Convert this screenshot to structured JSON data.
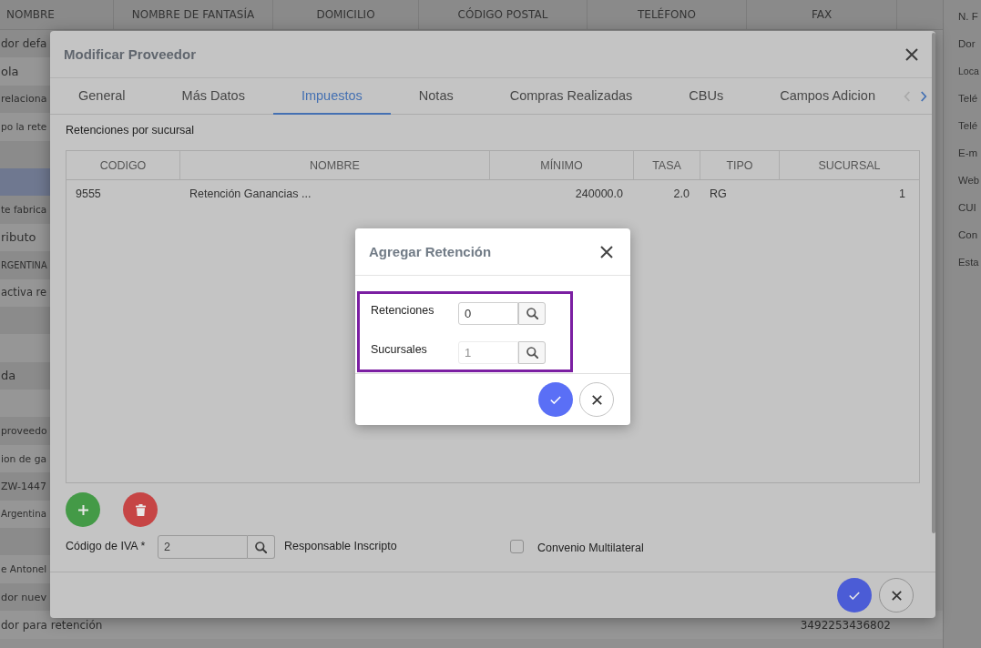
{
  "app": {
    "columns": [
      "NOMBRE",
      "NOMBRE DE FANTASÍA",
      "DOMICILIO",
      "CÓDIGO POSTAL",
      "TELÉFONO",
      "FAX"
    ],
    "rows": [
      {
        "name": "dor defa",
        "selected": false
      },
      {
        "name": "ola",
        "selected": false
      },
      {
        "name": "relaciona",
        "selected": false
      },
      {
        "name": "po la rete",
        "selected": false
      },
      {
        "selected": false
      },
      {
        "selected": true
      },
      {
        "name": "te fabrica",
        "selected": false
      },
      {
        "name": "ributo",
        "selected": false
      },
      {
        "name": "RGENTINA",
        "selected": false
      },
      {
        "name": "activa re",
        "selected": false
      },
      {
        "selected": false
      },
      {
        "selected": false
      },
      {
        "name": "da",
        "selected": false
      },
      {
        "selected": false
      },
      {
        "name": "proveedo",
        "selected": false
      },
      {
        "name": "ion de ga",
        "selected": false
      },
      {
        "name": "ZW-1447",
        "selected": false
      },
      {
        "name": "Argentina",
        "selected": false
      },
      {
        "selected": false
      },
      {
        "name": "e Antonel",
        "selected": false
      },
      {
        "name": "dor nuev",
        "selected": false
      },
      {
        "name": "dor para retención",
        "fax": "3492253436802",
        "selected": false
      }
    ]
  },
  "detail_panel": {
    "labels": [
      "N. F",
      "Dor",
      "Loca",
      "Telé",
      "Telé",
      "E-m",
      "Web",
      "CUI",
      "Con",
      "Esta"
    ]
  },
  "dialog": {
    "title": "Modificar Proveedor",
    "tabs": [
      {
        "label": "General",
        "selected": false
      },
      {
        "label": "Más Datos",
        "selected": false
      },
      {
        "label": "Impuestos",
        "selected": true
      },
      {
        "label": "Notas",
        "selected": false
      },
      {
        "label": "Compras Realizadas",
        "selected": false
      },
      {
        "label": "CBUs",
        "selected": false
      },
      {
        "label": "Campos Adicion",
        "selected": false
      }
    ],
    "tab_arrows": [
      {
        "kind": "left",
        "disabled": true
      },
      {
        "kind": "right",
        "disabled": false
      }
    ],
    "section_title": "Retenciones por sucursal",
    "table": {
      "columns": [
        "CODIGO",
        "NOMBRE",
        "MÍNIMO",
        "TASA",
        "TIPO",
        "SUCURSAL"
      ],
      "rows": [
        [
          "9555",
          "Retención Ganancias ...",
          "240000.0",
          "2.0",
          "RG",
          "1"
        ]
      ]
    },
    "iva": {
      "label": "Código de IVA *",
      "value": "2",
      "description": "Responsable Inscripto"
    },
    "convenio": {
      "label": "Convenio Multilateral",
      "checked": false
    }
  },
  "inner_dialog": {
    "title": "Agregar Retención",
    "fields": [
      {
        "label": "Retenciones",
        "value": "0",
        "disabled": false
      },
      {
        "label": "Sucursales",
        "value": "1",
        "disabled": true
      }
    ]
  }
}
